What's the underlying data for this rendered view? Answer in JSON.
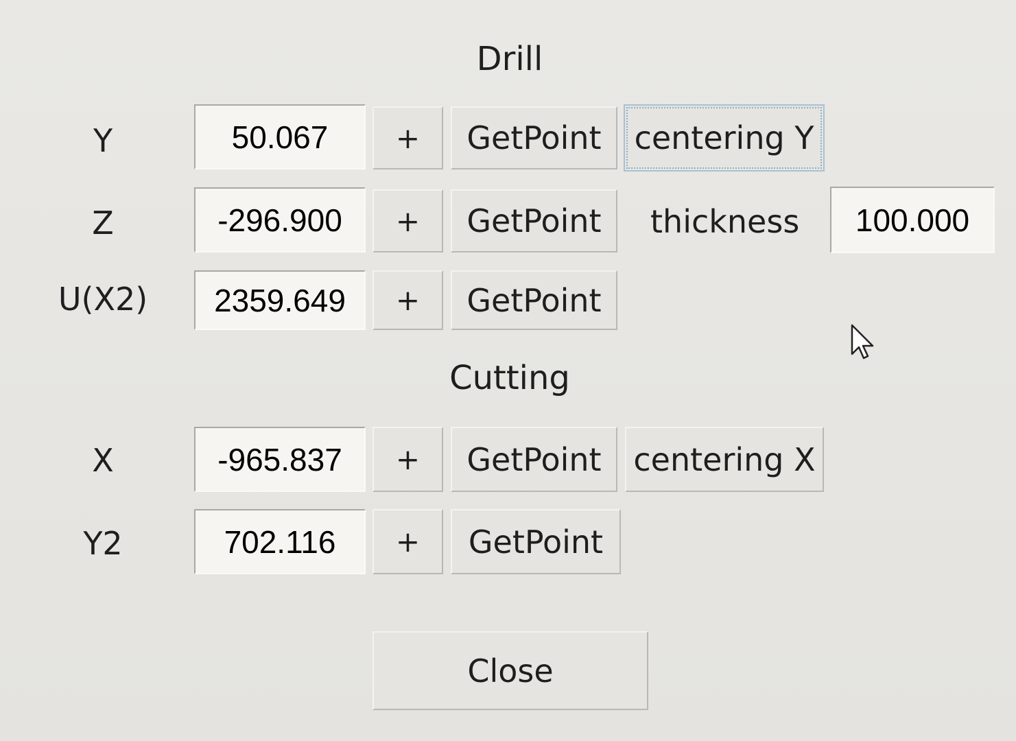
{
  "drill": {
    "title": "Drill",
    "rows": [
      {
        "label": "Y",
        "value": "50.067",
        "plus": "+",
        "getpoint": "GetPoint"
      },
      {
        "label": "Z",
        "value": "-296.900",
        "plus": "+",
        "getpoint": "GetPoint"
      },
      {
        "label": "U(X2)",
        "value": "2359.649",
        "plus": "+",
        "getpoint": "GetPoint"
      }
    ],
    "centering_y": "centering Y",
    "thickness_label": "thickness",
    "thickness_value": "100.000"
  },
  "cutting": {
    "title": "Cutting",
    "rows": [
      {
        "label": "X",
        "value": "-965.837",
        "plus": "+",
        "getpoint": "GetPoint"
      },
      {
        "label": "Y2",
        "value": "702.116",
        "plus": "+",
        "getpoint": "GetPoint"
      }
    ],
    "centering_x": "centering X"
  },
  "close_label": "Close",
  "icons": {
    "cursor": "arrow-cursor-icon"
  }
}
